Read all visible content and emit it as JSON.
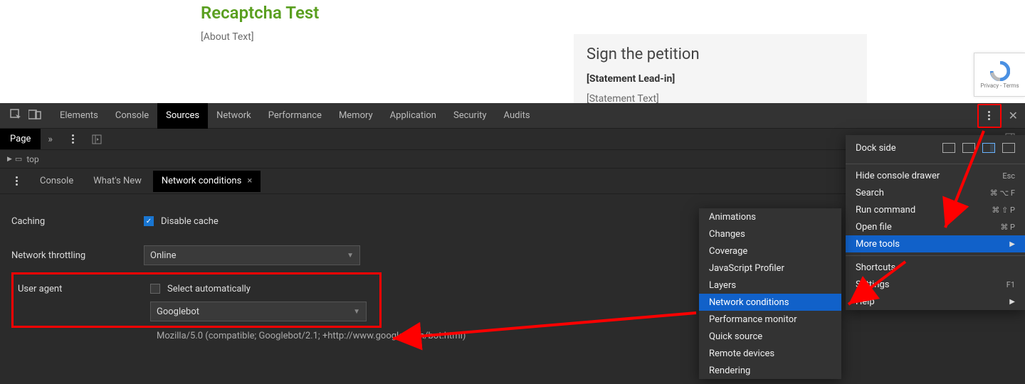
{
  "page": {
    "title": "Recaptcha Test",
    "about": "[About Text]",
    "petition": {
      "title": "Sign the petition",
      "lead": "[Statement Lead-in]",
      "text": "[Statement Text]"
    },
    "recaptcha": {
      "privacy": "Privacy",
      "terms": "Terms",
      "sep": " - "
    }
  },
  "devtools": {
    "tabs": [
      "Elements",
      "Console",
      "Sources",
      "Network",
      "Performance",
      "Memory",
      "Application",
      "Security",
      "Audits"
    ],
    "active_tab": "Sources",
    "subbar": {
      "page_label": "Page",
      "tree_label": "top"
    },
    "drawer": {
      "tabs": [
        "Console",
        "What's New",
        "Network conditions"
      ],
      "active": "Network conditions",
      "caching_label": "Caching",
      "disable_cache": "Disable cache",
      "throttling_label": "Network throttling",
      "throttling_value": "Online",
      "ua_label": "User agent",
      "ua_auto_label": "Select automatically",
      "ua_value": "Googlebot",
      "ua_string": "Mozilla/5.0 (compatible; Googlebot/2.1; +http://www.google.com/bot.html)"
    }
  },
  "main_menu": {
    "dock_label": "Dock side",
    "items": [
      {
        "label": "Hide console drawer",
        "shortcut": "Esc"
      },
      {
        "label": "Search",
        "shortcut": "⌘ ⌥ F"
      },
      {
        "label": "Run command",
        "shortcut": "⌘ ⇧ P"
      },
      {
        "label": "Open file",
        "shortcut": "⌘ P"
      },
      {
        "label": "More tools",
        "shortcut": "",
        "hover": true,
        "submenu": true
      }
    ],
    "items2": [
      {
        "label": "Shortcuts",
        "shortcut": ""
      },
      {
        "label": "Settings",
        "shortcut": "F1"
      },
      {
        "label": "Help",
        "shortcut": "",
        "submenu": true
      }
    ]
  },
  "tools_menu": {
    "items": [
      "Animations",
      "Changes",
      "Coverage",
      "JavaScript Profiler",
      "Layers",
      "Network conditions",
      "Performance monitor",
      "Quick source",
      "Remote devices",
      "Rendering"
    ],
    "hover": "Network conditions"
  }
}
